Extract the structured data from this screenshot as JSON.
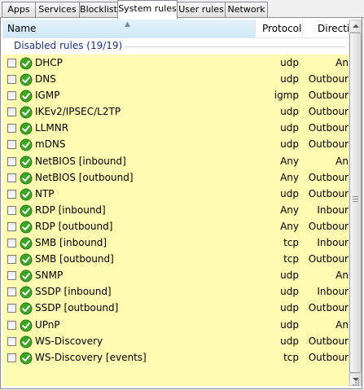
{
  "tabs": [
    {
      "label": "Apps",
      "active": false
    },
    {
      "label": "Services",
      "active": false
    },
    {
      "label": "Blocklist",
      "active": false
    },
    {
      "label": "System rules",
      "active": true
    },
    {
      "label": "User rules",
      "active": false
    },
    {
      "label": "Network",
      "active": false
    }
  ],
  "columns": {
    "name": "Name",
    "protocol": "Protocol",
    "direction": "Directio"
  },
  "group": {
    "label": "Disabled rules (19/19)"
  },
  "rows": [
    {
      "name": "DHCP",
      "protocol": "udp",
      "direction": "An"
    },
    {
      "name": "DNS",
      "protocol": "udp",
      "direction": "Outbour"
    },
    {
      "name": "IGMP",
      "protocol": "igmp",
      "direction": "Outbour"
    },
    {
      "name": "IKEv2/IPSEC/L2TP",
      "protocol": "udp",
      "direction": "Outbour"
    },
    {
      "name": "LLMNR",
      "protocol": "udp",
      "direction": "Outbour"
    },
    {
      "name": "mDNS",
      "protocol": "udp",
      "direction": "Outbour"
    },
    {
      "name": "NetBIOS [inbound]",
      "protocol": "Any",
      "direction": "An"
    },
    {
      "name": "NetBIOS [outbound]",
      "protocol": "Any",
      "direction": "Outbour"
    },
    {
      "name": "NTP",
      "protocol": "udp",
      "direction": "Outbour"
    },
    {
      "name": "RDP [inbound]",
      "protocol": "Any",
      "direction": "Inbour"
    },
    {
      "name": "RDP [outbound]",
      "protocol": "Any",
      "direction": "Outbour"
    },
    {
      "name": "SMB [inbound]",
      "protocol": "tcp",
      "direction": "Inbour"
    },
    {
      "name": "SMB [outbound]",
      "protocol": "tcp",
      "direction": "Outbour"
    },
    {
      "name": "SNMP",
      "protocol": "udp",
      "direction": "An"
    },
    {
      "name": "SSDP [inbound]",
      "protocol": "udp",
      "direction": "Inbour"
    },
    {
      "name": "SSDP [outbound]",
      "protocol": "udp",
      "direction": "Outbour"
    },
    {
      "name": "UPnP",
      "protocol": "udp",
      "direction": "An"
    },
    {
      "name": "WS-Discovery",
      "protocol": "udp",
      "direction": "Outbour"
    },
    {
      "name": "WS-Discovery [events]",
      "protocol": "tcp",
      "direction": "Outbour"
    }
  ],
  "icons": {
    "row_status": "green-check-icon",
    "sort": "sort-ascending-icon"
  },
  "colors": {
    "row_background": "#fffbb1",
    "group_text": "#1e3287",
    "check_green": "#3aa623"
  }
}
